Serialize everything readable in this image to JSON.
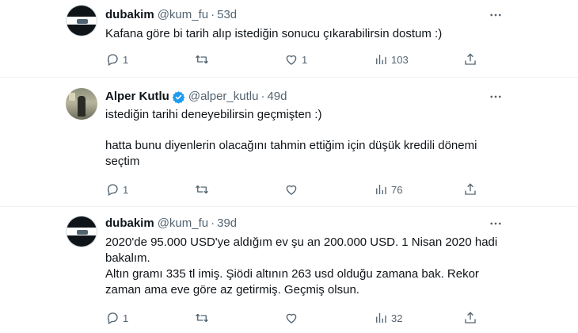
{
  "tweets": [
    {
      "name": "dubakim",
      "handle": "@kum_fu",
      "time": "53d",
      "verified": false,
      "lines": [
        "Kafana göre bi tarih alıp istediğin sonucu çıkarabilirsin dostum :)"
      ],
      "replies": "1",
      "retweets": "",
      "likes": "1",
      "views": "103"
    },
    {
      "name": "Alper Kutlu",
      "handle": "@alper_kutlu",
      "time": "49d",
      "verified": true,
      "lines": [
        "istediğin tarihi deneyebilirsin geçmişten :)",
        "hatta bunu diyenlerin olacağını tahmin ettiğim için düşük kredili dönemi",
        "seçtim"
      ],
      "replies": "1",
      "retweets": "",
      "likes": "",
      "views": "76"
    },
    {
      "name": "dubakim",
      "handle": "@kum_fu",
      "time": "39d",
      "verified": false,
      "lines": [
        "2020'de 95.000 USD'ye aldığım ev şu an 200.000 USD. 1 Nisan 2020 hadi",
        "bakalım.",
        "Altın gramı 335 tl imiş. Şiödi altının 263 usd olduğu zamana bak. Rekor",
        "zaman ama eve göre az getirmiş. Geçmiş olsun."
      ],
      "replies": "1",
      "retweets": "",
      "likes": "",
      "views": "32"
    }
  ],
  "separator": "·",
  "colors": {
    "text": "#0f1419",
    "muted": "#536471",
    "verified": "#1d9bf0",
    "divider": "#eff3f4"
  },
  "icons": [
    "reply-icon",
    "retweet-icon",
    "like-icon",
    "views-icon",
    "share-icon",
    "more-icon",
    "verified-badge-icon"
  ]
}
